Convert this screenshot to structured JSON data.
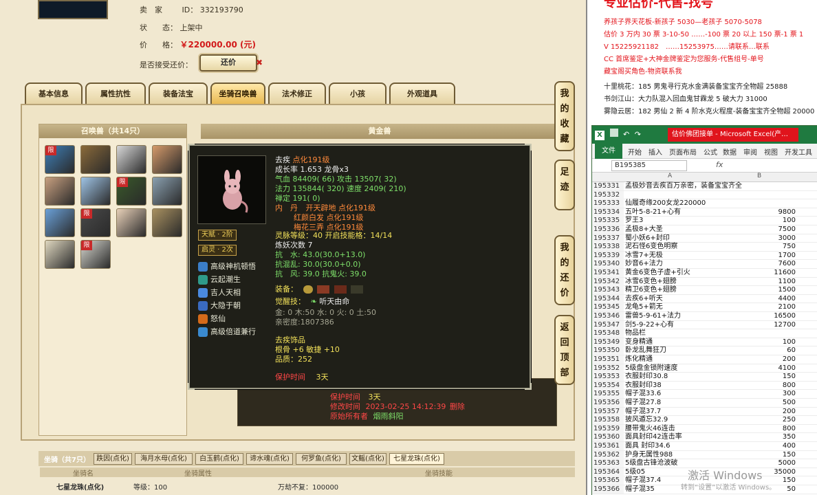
{
  "seller": {
    "seller_label": "卖　家",
    "id_label": "ID：",
    "id_value": "332193790",
    "status_label": "状　　态：",
    "status_value": "上架中",
    "price_label": "价　　格：",
    "price_value": "￥220000.00 (元)",
    "bargain_label": "是否接受还价：",
    "bargain_button": "还价",
    "bargain_x": "✖"
  },
  "tabs": [
    "基本信息",
    "属性抗性",
    "装备法宝",
    "坐骑召唤兽",
    "法术修正",
    "小孩",
    "外观道具"
  ],
  "active_tab_index": 3,
  "side_buttons": [
    "我的收藏",
    "足迹",
    "我的还价",
    "返回顶部"
  ],
  "summon": {
    "title": "召唤兽（共14只）",
    "pets": [
      {
        "limited": true
      },
      {
        "limited": false
      },
      {
        "limited": false
      },
      {
        "limited": false
      },
      {
        "limited": false
      },
      {
        "limited": false
      },
      {
        "limited": true
      },
      {
        "limited": false
      },
      {
        "limited": false
      },
      {
        "limited": true
      },
      {
        "limited": false
      },
      {
        "limited": false
      },
      {
        "limited": false
      },
      {
        "limited": true
      }
    ],
    "limited_tag": "限"
  },
  "detail": {
    "header": "黄金兽",
    "protect_label": "保护时间",
    "protect_value": "3天",
    "change_time_label": "修改时间",
    "change_time_value": "2023-02-25 14:12:39",
    "change_time_suffix": "删除",
    "original_owner_label": "原始所有者",
    "original_owner_value": "烟雨斜阳"
  },
  "tooltip": {
    "name": "去疾",
    "rank": "点化191级",
    "growth": "成长率 1.653 龙骨x3",
    "hp": "气血 84409( 66) 攻击 13507( 32)",
    "mp": "法力 135844( 320) 速度 2409( 210)",
    "zen": "禅定 191( 0)",
    "neidan_label": "内　丹",
    "neidan_1": "开天辟地 点化191级",
    "neidan_2": "红颜白发 点化191级",
    "neidan_3": "梅花三弄 点化191级",
    "spirit": "灵脉等级：40 开启技能格：14/14",
    "refine": "炼妖次数 7",
    "resist_water": "抗　水: 43.0(30.0+13.0)",
    "resist_confuse": "抗混乱: 30.0(30.0+0.0)",
    "resist_wind": "抗　风: 39.0 抗鬼火: 39.0",
    "tianfu": "天赋 · 2阶",
    "qiling": "启灵 · 2次",
    "skills": [
      "高级神机顿悟",
      "云起潮生",
      "吉人天相",
      "大隐于朝",
      "怒仙",
      "高级倍道兼行"
    ],
    "equip_label": "装备：",
    "awaken_label": "觉醒技：",
    "awaken_value": "听天由命",
    "elements": "金: 0 木:50 水: 0 火: 0 土:50",
    "intimacy": "亲密度:1807386",
    "ornament_label": "去疾饰品",
    "ornament_value": "根骨 +6 敏捷 +10",
    "quality": "品质：252",
    "protect_label": "保护时间",
    "protect_value": "3天"
  },
  "mounts": {
    "title": "坐骑（共7只）",
    "tabs": [
      "跌因(点化)",
      "海月水母(点化)",
      "白玉鹤(点化)",
      "谛水魂(点化)",
      "何罗鱼(点化)",
      "文鳐(点化)",
      "七星龙珠(点化)"
    ],
    "head_name": "坐骑名",
    "head_attr": "坐骑属性",
    "head_skill": "坐骑技能",
    "row_name": "七星龙珠(点化)",
    "row_level": "等级：100",
    "row_skill": "万劫不复：100000"
  },
  "doc": {
    "title": "专业估价-代售-找号",
    "lines": [
      {
        "text": "养孩子界天花板-新孩子 5030—老孩子 5070-5078",
        "color": "red"
      },
      {
        "text": "估价 3 万内 30 票 3-10-50 ……-100 票 20 以上 150 票-1 票 1",
        "color": "red"
      },
      {
        "text": "V 15225921182　……15253975……请联系…联系",
        "color": "red"
      },
      {
        "text": "CC 首席鉴定+大神金牌鉴定为您服务-代售组号-单号",
        "color": "red"
      },
      {
        "text": "藏宝阁买角色-物资联系我",
        "color": "red"
      },
      {
        "text": "十里桃花：185 男鬼寻行克水金满装备宝宝齐全物超 25888",
        "color": "black"
      },
      {
        "text": "书剑江山：大力队混入回血鬼甘霖龙 5 破大力 31000",
        "color": "black"
      },
      {
        "text": "雾隐云居：182 男仙 2 新 4 阶水克火程度-装备宝宝齐全物超 20000",
        "color": "black"
      }
    ]
  },
  "excel": {
    "caption": "估价佛团接单 - Microsoft Excel(产…",
    "ribbon_tabs": [
      "文件",
      "开始",
      "插入",
      "页面布局",
      "公式",
      "数据",
      "审阅",
      "视图",
      "开发工具"
    ],
    "namebox": "B195385",
    "fx": "fx",
    "col_a": "A",
    "col_b": "B",
    "rows": [
      {
        "n": "195331",
        "a": "孟极妙音去疾百万亲密，装备宝宝齐全",
        "b": ""
      },
      {
        "n": "195332",
        "a": "",
        "b": ""
      },
      {
        "n": "195333",
        "a": "仙履奇缘200女龙220000",
        "b": ""
      },
      {
        "n": "195334",
        "a": "五叶5-8-21+心有",
        "b": "9800"
      },
      {
        "n": "195335",
        "a": "罗王3",
        "b": "100"
      },
      {
        "n": "195336",
        "a": "孟极8+大圣",
        "b": "7500"
      },
      {
        "n": "195337",
        "a": "蜀小妖6+封印",
        "b": "3000"
      },
      {
        "n": "195338",
        "a": "泥石怪6变色明察",
        "b": "750"
      },
      {
        "n": "195339",
        "a": "冰雪7+无极",
        "b": "1700"
      },
      {
        "n": "195340",
        "a": "妙音6+法力",
        "b": "7600"
      },
      {
        "n": "195341",
        "a": "黄金6变色子虚+引火",
        "b": "11600"
      },
      {
        "n": "195342",
        "a": "冰雪6变色+翅膀",
        "b": "1100"
      },
      {
        "n": "195343",
        "a": "精卫6变色+翅膀",
        "b": "1500"
      },
      {
        "n": "195344",
        "a": "去疾6+听天",
        "b": "4400"
      },
      {
        "n": "195345",
        "a": "龙龟5+箭无",
        "b": "2100"
      },
      {
        "n": "195346",
        "a": "雷兽5-9-61+法力",
        "b": "16500"
      },
      {
        "n": "195347",
        "a": "剑5-9-22+心有",
        "b": "12700"
      },
      {
        "n": "195348",
        "a": "物品栏",
        "b": ""
      },
      {
        "n": "195349",
        "a": "变身精通",
        "b": "100"
      },
      {
        "n": "195350",
        "a": "卧龙乱舞狂刀",
        "b": "60"
      },
      {
        "n": "195351",
        "a": "炼化精通",
        "b": "200"
      },
      {
        "n": "195352",
        "a": "5级盘金锁附速度",
        "b": "4100"
      },
      {
        "n": "195353",
        "a": "衣服封印30.8",
        "b": "150"
      },
      {
        "n": "195354",
        "a": "衣服封印38",
        "b": "800"
      },
      {
        "n": "195355",
        "a": "帽子混33.6",
        "b": "300"
      },
      {
        "n": "195356",
        "a": "帽子混27.8",
        "b": "500"
      },
      {
        "n": "195357",
        "a": "帽子混37.7",
        "b": "200"
      },
      {
        "n": "195358",
        "a": "披风遁忘32.9",
        "b": "250"
      },
      {
        "n": "195359",
        "a": "腰带鬼火46连击",
        "b": "800"
      },
      {
        "n": "195360",
        "a": "面具封印42连击率",
        "b": "350"
      },
      {
        "n": "195361",
        "a": "面具 封印34.6",
        "b": "400"
      },
      {
        "n": "195362",
        "a": "护身无属性988",
        "b": "150"
      },
      {
        "n": "195363",
        "a": "5级盘古锋沧波破",
        "b": "5000"
      },
      {
        "n": "195364",
        "a": "5级05",
        "b": "35000"
      },
      {
        "n": "195365",
        "a": "帽子混37.4",
        "b": "150"
      },
      {
        "n": "195366",
        "a": "帽子混35",
        "b": "50"
      }
    ]
  },
  "watermark": {
    "line1": "激活 Windows",
    "line2": "转到“设置”以激活 Windows。"
  }
}
